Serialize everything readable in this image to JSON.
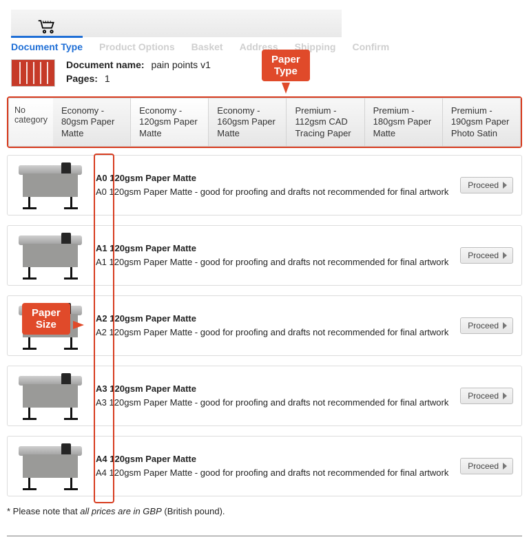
{
  "header": {},
  "steps": {
    "items": [
      "Document Type",
      "Product Options",
      "Basket",
      "Address",
      "Shipping",
      "Confirm"
    ],
    "active_index": 0
  },
  "doc": {
    "name_label": "Document name:",
    "name_value": "pain points v1",
    "pages_label": "Pages:",
    "pages_value": "1"
  },
  "annotations": {
    "paper_type": "Paper\nType",
    "paper_size": "Paper\nSize"
  },
  "tabs": {
    "no_category": "No\ncategory",
    "items": [
      "Economy - 80gsm Paper Matte",
      "Economy - 120gsm Paper Matte",
      "Economy - 160gsm Paper Matte",
      "Premium - 112gsm CAD Tracing Paper",
      "Premium - 180gsm Paper Matte",
      "Premium - 190gsm Paper Photo Satin"
    ],
    "selected_index": 1
  },
  "products": [
    {
      "title": "A0 120gsm Paper Matte",
      "desc": "A0 120gsm Paper Matte - good for proofing and drafts not recommended for final artwork",
      "button": "Proceed"
    },
    {
      "title": "A1 120gsm Paper Matte",
      "desc": "A1 120gsm Paper Matte - good for proofing and drafts not recommended for final artwork",
      "button": "Proceed"
    },
    {
      "title": "A2 120gsm Paper Matte",
      "desc": "A2 120gsm Paper Matte - good for proofing and drafts not recommended for final artwork",
      "button": "Proceed"
    },
    {
      "title": "A3 120gsm Paper Matte",
      "desc": "A3 120gsm Paper Matte - good for proofing and drafts not recommended for final artwork",
      "button": "Proceed"
    },
    {
      "title": "A4 120gsm Paper Matte",
      "desc": "A4 120gsm Paper Matte - good for proofing and drafts not recommended for final artwork",
      "button": "Proceed"
    }
  ],
  "footnote": {
    "prefix": "* Please note that ",
    "em": "all prices are in GBP",
    "suffix": " (British pound)."
  }
}
